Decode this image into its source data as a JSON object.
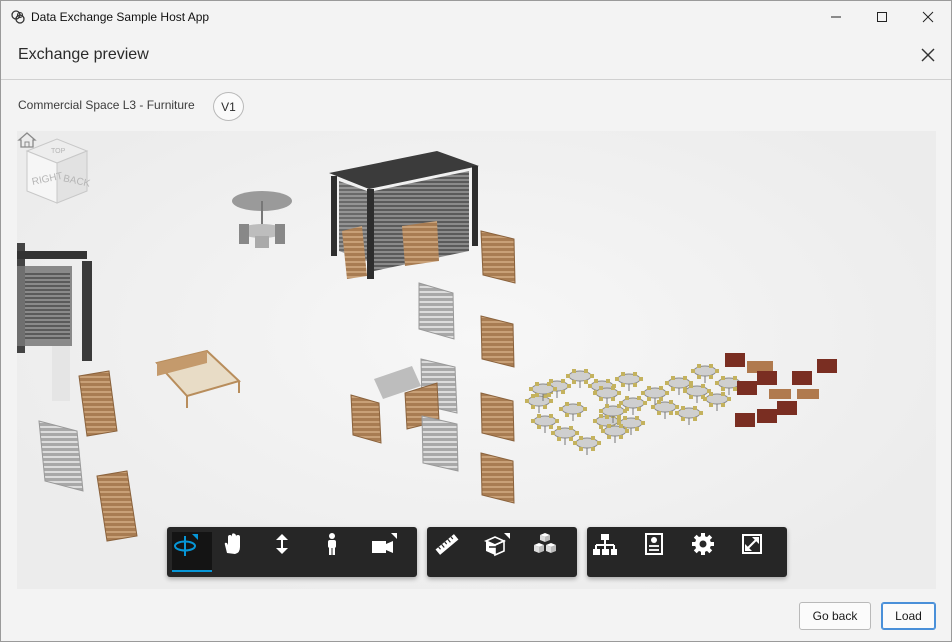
{
  "window": {
    "title": "Data Exchange Sample Host App",
    "controls": [
      "minimize",
      "maximize",
      "close"
    ]
  },
  "header": {
    "title": "Exchange preview"
  },
  "exchange": {
    "name": "Commercial Space L3 - Furniture",
    "version": "V1"
  },
  "viewer": {
    "viewcube_faces": [
      "RIGHT",
      "BACK",
      "TOP"
    ],
    "toolbar_groups": [
      {
        "tools": [
          {
            "name": "orbit",
            "icon": "orbit-icon",
            "active": true
          },
          {
            "name": "pan",
            "icon": "hand-icon",
            "active": false
          },
          {
            "name": "zoom",
            "icon": "zoom-arrows-icon",
            "active": false
          },
          {
            "name": "first-person",
            "icon": "person-icon",
            "active": false
          },
          {
            "name": "camera",
            "icon": "camera-icon",
            "active": false
          }
        ]
      },
      {
        "tools": [
          {
            "name": "measure",
            "icon": "ruler-icon",
            "active": false
          },
          {
            "name": "section",
            "icon": "section-box-icon",
            "active": false
          },
          {
            "name": "explode",
            "icon": "explode-cubes-icon",
            "active": false
          }
        ]
      },
      {
        "tools": [
          {
            "name": "model-browser",
            "icon": "hierarchy-icon",
            "active": false
          },
          {
            "name": "properties",
            "icon": "properties-panel-icon",
            "active": false
          },
          {
            "name": "settings",
            "icon": "gear-icon",
            "active": false
          },
          {
            "name": "fullscreen",
            "icon": "fullscreen-icon",
            "active": false
          }
        ]
      }
    ],
    "accent_color": "#0696d7"
  },
  "footer": {
    "go_back_label": "Go back",
    "load_label": "Load"
  }
}
